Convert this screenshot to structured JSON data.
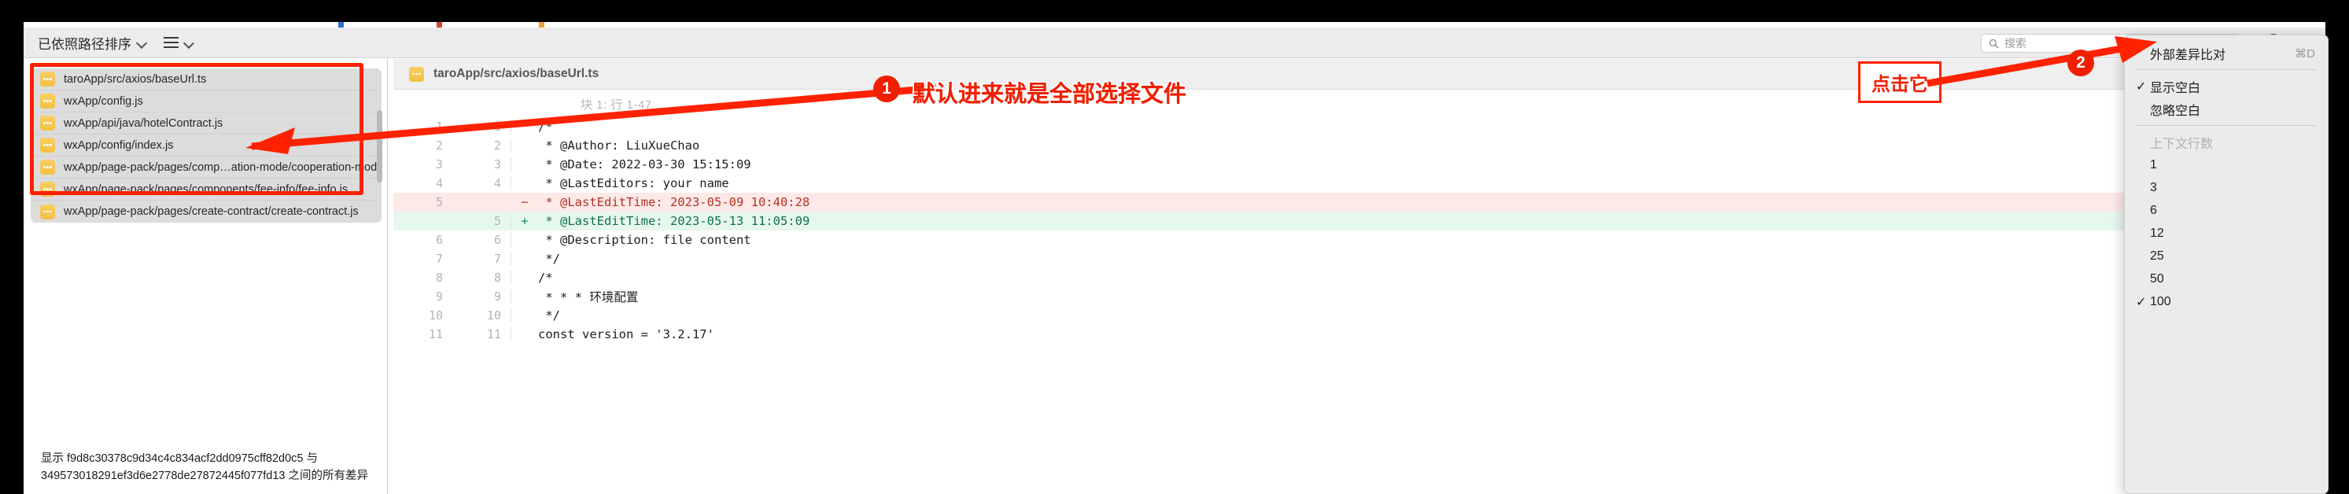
{
  "toolbar": {
    "sort_label": "已依照路径排序",
    "sort_icon": "chevron-down-icon",
    "list_icon": "hamburger-icon",
    "search_placeholder": "搜索",
    "search_icon": "search-icon",
    "more_icon": "ellipsis-circle-icon"
  },
  "file_list": {
    "items": [
      {
        "name": "taroApp/src/axios/baseUrl.ts",
        "icon": "modified-file-icon"
      },
      {
        "name": "wxApp/config.js",
        "icon": "modified-file-icon"
      },
      {
        "name": "wxApp/api/java/hotelContract.js",
        "icon": "modified-file-icon"
      },
      {
        "name": "wxApp/config/index.js",
        "icon": "modified-file-icon"
      },
      {
        "name": "wxApp/page-pack/pages/comp…ation-mode/cooperation-mode.js",
        "icon": "modified-file-icon"
      },
      {
        "name": "wxApp/page-pack/pages/components/fee-info/fee-info.js",
        "icon": "modified-file-icon"
      },
      {
        "name": "wxApp/page-pack/pages/create-contract/create-contract.js",
        "icon": "modified-file-icon"
      }
    ]
  },
  "status": {
    "line1": "显示 f9d8c30378c9d34c4c834acf2dd0975cff82d0c5 与",
    "line2": "349573018291ef3d6e2778de27872445f077fd13 之间的所有差异"
  },
  "diff": {
    "file_title": "taroApp/src/axios/baseUrl.ts",
    "file_icon": "modified-file-icon",
    "hunk_label": "块 1: 行 1-47",
    "lines": [
      {
        "old": "1",
        "new": "1",
        "sign": "",
        "text": "/*",
        "type": "ctx"
      },
      {
        "old": "2",
        "new": "2",
        "sign": "",
        "text": " * @Author: LiuXueChao",
        "type": "ctx"
      },
      {
        "old": "3",
        "new": "3",
        "sign": "",
        "text": " * @Date: 2022-03-30 15:15:09",
        "type": "ctx"
      },
      {
        "old": "4",
        "new": "4",
        "sign": "",
        "text": " * @LastEditors: your name",
        "type": "ctx"
      },
      {
        "old": "5",
        "new": "",
        "sign": "−",
        "text": " * @LastEditTime: 2023-05-09 10:40:28",
        "type": "del"
      },
      {
        "old": "",
        "new": "5",
        "sign": "+",
        "text": " * @LastEditTime: 2023-05-13 11:05:09",
        "type": "add"
      },
      {
        "old": "6",
        "new": "6",
        "sign": "",
        "text": " * @Description: file content",
        "type": "ctx"
      },
      {
        "old": "7",
        "new": "7",
        "sign": "",
        "text": " */",
        "type": "ctx"
      },
      {
        "old": "8",
        "new": "8",
        "sign": "",
        "text": "/*",
        "type": "ctx"
      },
      {
        "old": "9",
        "new": "9",
        "sign": "",
        "text": " * * * 环境配置",
        "type": "ctx"
      },
      {
        "old": "10",
        "new": "10",
        "sign": "",
        "text": " */",
        "type": "ctx"
      },
      {
        "old": "11",
        "new": "11",
        "sign": "",
        "text": "const version = '3.2.17'",
        "type": "ctx"
      }
    ]
  },
  "menu": {
    "items": [
      {
        "kind": "item",
        "checked": false,
        "label": "外部差异比对",
        "shortcut": "⌘D"
      },
      {
        "kind": "sep"
      },
      {
        "kind": "item",
        "checked": true,
        "label": "显示空白",
        "shortcut": ""
      },
      {
        "kind": "item",
        "checked": false,
        "label": "忽略空白",
        "shortcut": ""
      },
      {
        "kind": "sep"
      },
      {
        "kind": "header",
        "label": "上下文行数"
      },
      {
        "kind": "item",
        "checked": false,
        "label": "1",
        "shortcut": ""
      },
      {
        "kind": "item",
        "checked": false,
        "label": "3",
        "shortcut": ""
      },
      {
        "kind": "item",
        "checked": false,
        "label": "6",
        "shortcut": ""
      },
      {
        "kind": "item",
        "checked": false,
        "label": "12",
        "shortcut": ""
      },
      {
        "kind": "item",
        "checked": false,
        "label": "25",
        "shortcut": ""
      },
      {
        "kind": "item",
        "checked": false,
        "label": "50",
        "shortcut": ""
      },
      {
        "kind": "item",
        "checked": true,
        "label": "100",
        "shortcut": ""
      }
    ]
  },
  "annotations": {
    "badge_one": "1",
    "badge_two": "2",
    "note_one": "默认进来就是全部选择文件",
    "note_two": "点击它"
  },
  "colors": {
    "annotation_red": "#f01f00",
    "file_icon_yellow": "#f3c043",
    "diff_add_bg": "#e6f7ee",
    "diff_del_bg": "#fde9e7"
  }
}
